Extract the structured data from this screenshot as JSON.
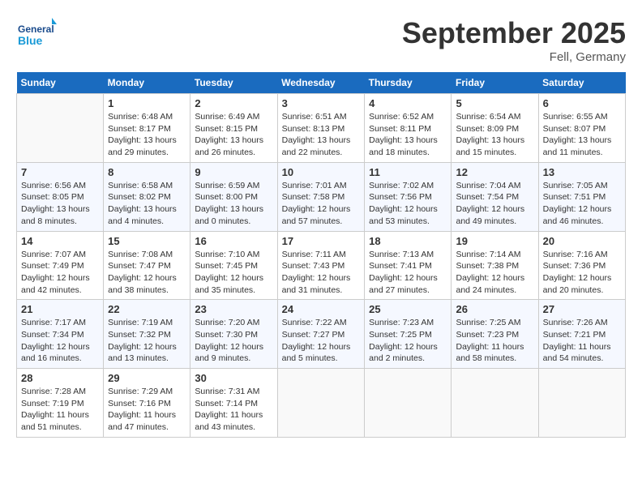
{
  "header": {
    "logo_text_general": "General",
    "logo_text_blue": "Blue",
    "month_title": "September 2025",
    "location": "Fell, Germany"
  },
  "days_of_week": [
    "Sunday",
    "Monday",
    "Tuesday",
    "Wednesday",
    "Thursday",
    "Friday",
    "Saturday"
  ],
  "weeks": [
    [
      {
        "day": "",
        "sunrise": "",
        "sunset": "",
        "daylight": ""
      },
      {
        "day": "1",
        "sunrise": "Sunrise: 6:48 AM",
        "sunset": "Sunset: 8:17 PM",
        "daylight": "Daylight: 13 hours and 29 minutes."
      },
      {
        "day": "2",
        "sunrise": "Sunrise: 6:49 AM",
        "sunset": "Sunset: 8:15 PM",
        "daylight": "Daylight: 13 hours and 26 minutes."
      },
      {
        "day": "3",
        "sunrise": "Sunrise: 6:51 AM",
        "sunset": "Sunset: 8:13 PM",
        "daylight": "Daylight: 13 hours and 22 minutes."
      },
      {
        "day": "4",
        "sunrise": "Sunrise: 6:52 AM",
        "sunset": "Sunset: 8:11 PM",
        "daylight": "Daylight: 13 hours and 18 minutes."
      },
      {
        "day": "5",
        "sunrise": "Sunrise: 6:54 AM",
        "sunset": "Sunset: 8:09 PM",
        "daylight": "Daylight: 13 hours and 15 minutes."
      },
      {
        "day": "6",
        "sunrise": "Sunrise: 6:55 AM",
        "sunset": "Sunset: 8:07 PM",
        "daylight": "Daylight: 13 hours and 11 minutes."
      }
    ],
    [
      {
        "day": "7",
        "sunrise": "Sunrise: 6:56 AM",
        "sunset": "Sunset: 8:05 PM",
        "daylight": "Daylight: 13 hours and 8 minutes."
      },
      {
        "day": "8",
        "sunrise": "Sunrise: 6:58 AM",
        "sunset": "Sunset: 8:02 PM",
        "daylight": "Daylight: 13 hours and 4 minutes."
      },
      {
        "day": "9",
        "sunrise": "Sunrise: 6:59 AM",
        "sunset": "Sunset: 8:00 PM",
        "daylight": "Daylight: 13 hours and 0 minutes."
      },
      {
        "day": "10",
        "sunrise": "Sunrise: 7:01 AM",
        "sunset": "Sunset: 7:58 PM",
        "daylight": "Daylight: 12 hours and 57 minutes."
      },
      {
        "day": "11",
        "sunrise": "Sunrise: 7:02 AM",
        "sunset": "Sunset: 7:56 PM",
        "daylight": "Daylight: 12 hours and 53 minutes."
      },
      {
        "day": "12",
        "sunrise": "Sunrise: 7:04 AM",
        "sunset": "Sunset: 7:54 PM",
        "daylight": "Daylight: 12 hours and 49 minutes."
      },
      {
        "day": "13",
        "sunrise": "Sunrise: 7:05 AM",
        "sunset": "Sunset: 7:51 PM",
        "daylight": "Daylight: 12 hours and 46 minutes."
      }
    ],
    [
      {
        "day": "14",
        "sunrise": "Sunrise: 7:07 AM",
        "sunset": "Sunset: 7:49 PM",
        "daylight": "Daylight: 12 hours and 42 minutes."
      },
      {
        "day": "15",
        "sunrise": "Sunrise: 7:08 AM",
        "sunset": "Sunset: 7:47 PM",
        "daylight": "Daylight: 12 hours and 38 minutes."
      },
      {
        "day": "16",
        "sunrise": "Sunrise: 7:10 AM",
        "sunset": "Sunset: 7:45 PM",
        "daylight": "Daylight: 12 hours and 35 minutes."
      },
      {
        "day": "17",
        "sunrise": "Sunrise: 7:11 AM",
        "sunset": "Sunset: 7:43 PM",
        "daylight": "Daylight: 12 hours and 31 minutes."
      },
      {
        "day": "18",
        "sunrise": "Sunrise: 7:13 AM",
        "sunset": "Sunset: 7:41 PM",
        "daylight": "Daylight: 12 hours and 27 minutes."
      },
      {
        "day": "19",
        "sunrise": "Sunrise: 7:14 AM",
        "sunset": "Sunset: 7:38 PM",
        "daylight": "Daylight: 12 hours and 24 minutes."
      },
      {
        "day": "20",
        "sunrise": "Sunrise: 7:16 AM",
        "sunset": "Sunset: 7:36 PM",
        "daylight": "Daylight: 12 hours and 20 minutes."
      }
    ],
    [
      {
        "day": "21",
        "sunrise": "Sunrise: 7:17 AM",
        "sunset": "Sunset: 7:34 PM",
        "daylight": "Daylight: 12 hours and 16 minutes."
      },
      {
        "day": "22",
        "sunrise": "Sunrise: 7:19 AM",
        "sunset": "Sunset: 7:32 PM",
        "daylight": "Daylight: 12 hours and 13 minutes."
      },
      {
        "day": "23",
        "sunrise": "Sunrise: 7:20 AM",
        "sunset": "Sunset: 7:30 PM",
        "daylight": "Daylight: 12 hours and 9 minutes."
      },
      {
        "day": "24",
        "sunrise": "Sunrise: 7:22 AM",
        "sunset": "Sunset: 7:27 PM",
        "daylight": "Daylight: 12 hours and 5 minutes."
      },
      {
        "day": "25",
        "sunrise": "Sunrise: 7:23 AM",
        "sunset": "Sunset: 7:25 PM",
        "daylight": "Daylight: 12 hours and 2 minutes."
      },
      {
        "day": "26",
        "sunrise": "Sunrise: 7:25 AM",
        "sunset": "Sunset: 7:23 PM",
        "daylight": "Daylight: 11 hours and 58 minutes."
      },
      {
        "day": "27",
        "sunrise": "Sunrise: 7:26 AM",
        "sunset": "Sunset: 7:21 PM",
        "daylight": "Daylight: 11 hours and 54 minutes."
      }
    ],
    [
      {
        "day": "28",
        "sunrise": "Sunrise: 7:28 AM",
        "sunset": "Sunset: 7:19 PM",
        "daylight": "Daylight: 11 hours and 51 minutes."
      },
      {
        "day": "29",
        "sunrise": "Sunrise: 7:29 AM",
        "sunset": "Sunset: 7:16 PM",
        "daylight": "Daylight: 11 hours and 47 minutes."
      },
      {
        "day": "30",
        "sunrise": "Sunrise: 7:31 AM",
        "sunset": "Sunset: 7:14 PM",
        "daylight": "Daylight: 11 hours and 43 minutes."
      },
      {
        "day": "",
        "sunrise": "",
        "sunset": "",
        "daylight": ""
      },
      {
        "day": "",
        "sunrise": "",
        "sunset": "",
        "daylight": ""
      },
      {
        "day": "",
        "sunrise": "",
        "sunset": "",
        "daylight": ""
      },
      {
        "day": "",
        "sunrise": "",
        "sunset": "",
        "daylight": ""
      }
    ]
  ]
}
